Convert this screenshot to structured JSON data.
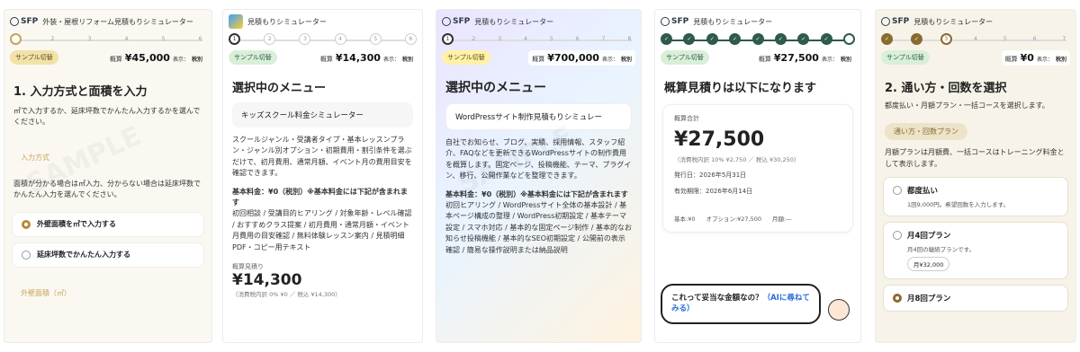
{
  "panel1": {
    "logo": "SFP",
    "title": "外装・屋根リフォーム見積もりシミュレーター",
    "steps": [
      "1",
      "2",
      "3",
      "4",
      "5",
      "6"
    ],
    "sample": "サンプル切替",
    "price_label": "概算",
    "price": "¥45,000",
    "tax_label": "表示：",
    "tax_value": "税別",
    "heading": "1. 入力方式と面積を入力",
    "intro": "㎡で入力するか、延床坪数でかんたん入力するかを選んでください。",
    "tag1": "入力方式",
    "note": "面積が分かる場合は㎡入力、分からない場合は延床坪数でかんたん入力を選んでください。",
    "opt1": "外壁面積を㎡で入力する",
    "opt2": "延床坪数でかんたん入力する",
    "tag2": "外壁面積（㎡）"
  },
  "panel2": {
    "title": "見積もりシミュレーター",
    "steps": [
      "1",
      "2",
      "3",
      "4",
      "5",
      "6"
    ],
    "sample": "サンプル切替",
    "price_label": "概算",
    "price": "¥14,300",
    "tax_label": "表示：",
    "tax_value": "税別",
    "heading": "選択中のメニュー",
    "menu": "キッズスクール料金シミュレーター",
    "desc": "スクールジャンル・受講者タイプ・基本レッスンプラン・ジャンル別オプション・初期費用・割引条件を選ぶだけで、初月費用、通常月額、イベント月の費用目安を確認できます。",
    "base": "基本料金：¥0（税別）※基本料金には下記が含まれます",
    "includes": "初回相談 / 受講目的ヒアリング / 対象年齢・レベル確認 / おすすめクラス提案 / 初月費用・通常月額・イベント月費用の目安確認 / 無料体験レッスン案内 / 見積明細PDF・コピー用テキスト",
    "sum_label": "概算見積り",
    "sum": "¥14,300",
    "tax_note": "（消費税内訳 0% ¥0 ／ 税込 ¥14,300）"
  },
  "panel3": {
    "logo": "SFP",
    "title": "見積もりシミュレーター",
    "steps": [
      "1",
      "2",
      "3",
      "4",
      "5",
      "6",
      "7",
      "8"
    ],
    "sample": "サンプル切替",
    "price_label": "概算",
    "price": "¥700,000",
    "tax_label": "表示：",
    "tax_value": "税別",
    "heading": "選択中のメニュー",
    "menu": "WordPressサイト制作見積もりシミュレー",
    "desc": "自社でお知らせ、ブログ、実績、採用情報、スタッフ紹介、FAQなどを更新できるWordPressサイトの制作費用を概算します。固定ページ、投稿機能、テーマ、プラグイン、移行、公開作業などを整理できます。",
    "base": "基本料金：¥0（税別）※基本料金には下記が含まれます",
    "includes": "初回ヒアリング / WordPressサイト全体の基本設計 / 基本ページ構成の整理 / WordPress初期設定 / 基本テーマ設定 / スマホ対応 / 基本的な固定ページ制作 / 基本的なお知らせ投稿機能 / 基本的なSEO初期設定 / 公開前の表示確認 / 簡易な操作説明または納品説明"
  },
  "panel4": {
    "logo": "SFP",
    "title": "見積もりシミュレーター",
    "sample": "サンプル切替",
    "price_label": "概算",
    "price": "¥27,500",
    "tax_label": "表示：",
    "tax_value": "税別",
    "heading": "概算見積りは以下になります",
    "total_label": "概算合計",
    "total": "¥27,500",
    "tax_note": "（消費税内訳 10% ¥2,750 ／ 税込 ¥30,250）",
    "issued": "発行日：2026年5月31日",
    "valid": "有効期限：2026年6月14日",
    "foot_base": "基本:¥0",
    "foot_opt": "オプション:¥27,500",
    "foot_month": "月額:—",
    "bubble_text": "これって妥当な金額なの？",
    "bubble_link": "（AIに尋ねてみる）"
  },
  "panel5": {
    "logo": "SFP",
    "title": "見積もりシミュレーター",
    "steps": [
      "1",
      "2",
      "3",
      "4",
      "5",
      "6",
      "7"
    ],
    "sample": "サンプル切替",
    "price_label": "概算",
    "price": "¥0",
    "tax_label": "表示：",
    "tax_value": "税別",
    "heading": "2. 通い方・回数を選択",
    "intro": "都度払い・月額プラン・一括コースを選択します。",
    "tag": "通い方・回数プラン",
    "note": "月額プランは月額費、一括コースはトレーニング料金として表示します。",
    "plan1_name": "都度払い",
    "plan1_desc": "1回9,000円。希望回数を入力します。",
    "plan2_name": "月4回プラン",
    "plan2_desc": "月4回の継続プランです。",
    "plan2_price": "月¥32,000",
    "plan3_name": "月8回プラン"
  },
  "colors": {
    "accent": "#b8893a",
    "done": "#2f5a4c",
    "link": "#2a6cd8"
  }
}
